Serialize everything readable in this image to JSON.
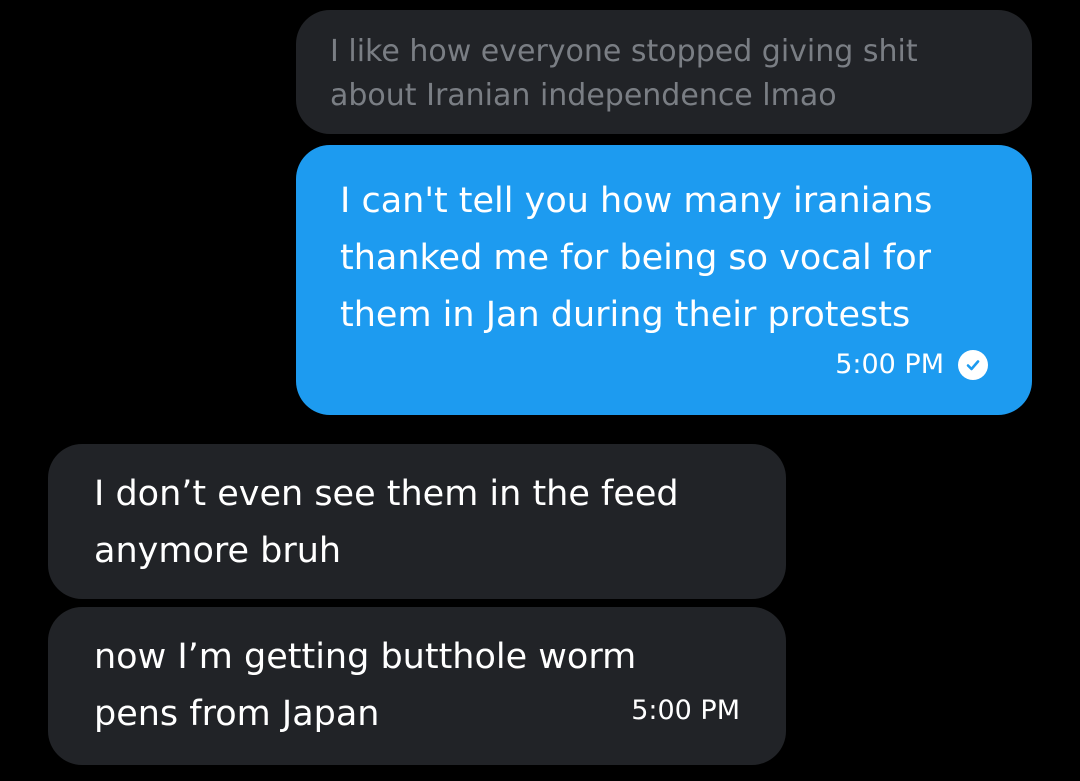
{
  "messages": [
    {
      "kind": "quoted",
      "text": "I like how everyone stopped giving shit\nabout Iranian independence lmao"
    },
    {
      "kind": "sent",
      "text": "I can't tell you how many iranians\nthanked me for being so vocal for\nthem in Jan during their protests",
      "time": "5:00 PM",
      "status_icon": "check-circle-icon"
    },
    {
      "kind": "received",
      "text": "I don’t even see them in the feed\nanymore bruh"
    },
    {
      "kind": "received",
      "text": "now I’m getting butthole worm\npens from Japan",
      "time": "5:00 PM"
    }
  ],
  "colors": {
    "background": "#000000",
    "sent_bubble": "#1d9bf0",
    "received_bubble": "#212327",
    "quoted_text": "#7a7e84",
    "text": "#ffffff"
  }
}
